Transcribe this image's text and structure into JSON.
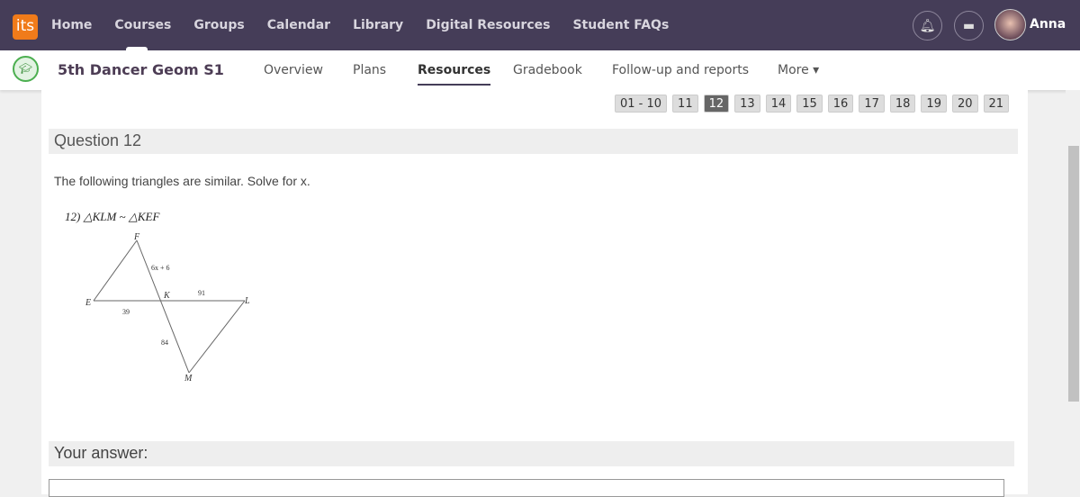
{
  "topbar": {
    "logo": "its",
    "nav": [
      "Home",
      "Courses",
      "Groups",
      "Calendar",
      "Library",
      "Digital Resources",
      "Student FAQs"
    ],
    "user": "Anna",
    "icons": [
      "bell-icon",
      "chat-icon"
    ]
  },
  "course": {
    "title": "5th Dancer Geom S1",
    "tabs": [
      "Overview",
      "Plans",
      "Resources",
      "Gradebook",
      "Follow-up and reports",
      "More ▾"
    ],
    "active_tab": "Resources"
  },
  "pager": {
    "pages": [
      "01 - 10",
      "11",
      "12",
      "13",
      "14",
      "15",
      "16",
      "17",
      "18",
      "19",
      "20",
      "21"
    ],
    "current": "12"
  },
  "question": {
    "title": "Question 12",
    "prompt": "The following triangles are similar. Solve for x.",
    "figure_label": "12) △KLM ~ △KEF",
    "vertices": [
      "F",
      "E",
      "K",
      "L",
      "M"
    ],
    "lengths": [
      "6x + 6",
      "91",
      "39",
      "84"
    ]
  },
  "answer": {
    "label": "Your answer:",
    "value": ""
  },
  "colors": {
    "topbar": "#453d58",
    "logo": "#f07b1a"
  }
}
